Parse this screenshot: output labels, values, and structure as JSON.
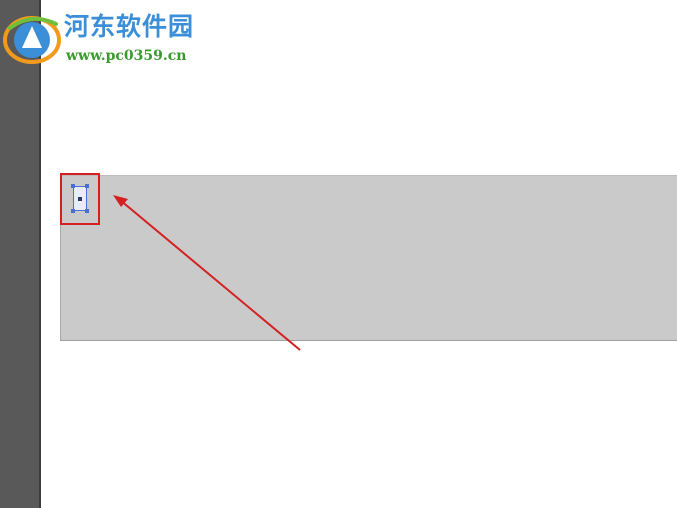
{
  "watermark": {
    "title": "河东软件园",
    "url": "www.pc0359.cn"
  },
  "colors": {
    "panel": "#595959",
    "artboard": "#cacaca",
    "annotation_red": "#d42020",
    "selection_blue": "#4a6fd0",
    "watermark_blue": "#3b8fd9",
    "watermark_green": "#3a9a2e"
  },
  "icons": {
    "logo": "pc0359-logo-icon",
    "frame": "text-frame-icon",
    "arrow": "annotation-arrow-icon"
  }
}
